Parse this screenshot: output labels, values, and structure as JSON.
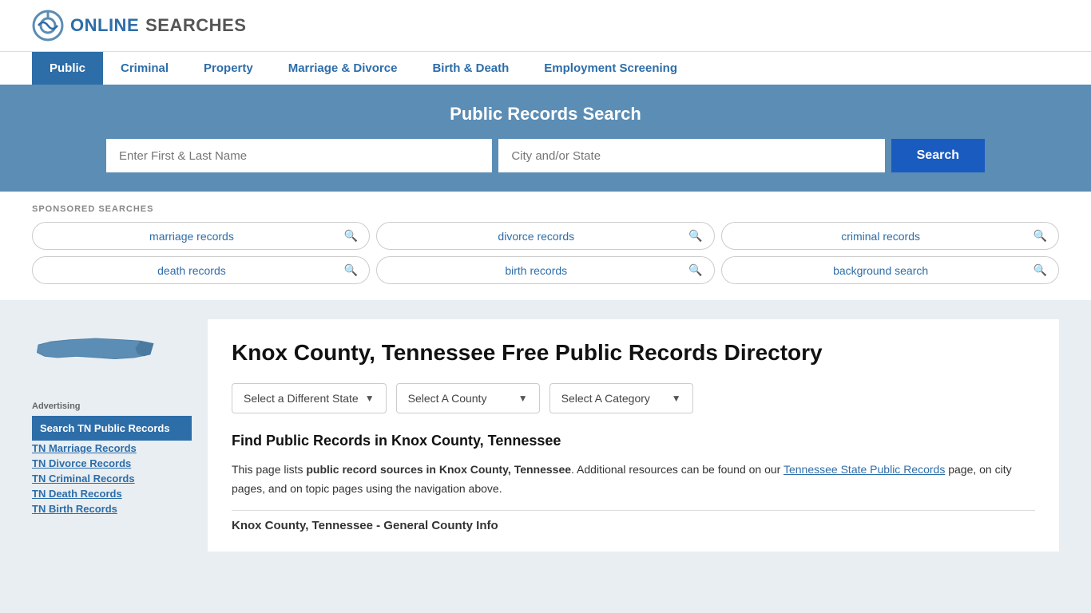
{
  "header": {
    "logo_online": "ONLINE",
    "logo_searches": "SEARCHES"
  },
  "nav": {
    "items": [
      {
        "label": "Public",
        "active": true
      },
      {
        "label": "Criminal",
        "active": false
      },
      {
        "label": "Property",
        "active": false
      },
      {
        "label": "Marriage & Divorce",
        "active": false
      },
      {
        "label": "Birth & Death",
        "active": false
      },
      {
        "label": "Employment Screening",
        "active": false
      }
    ]
  },
  "search_banner": {
    "title": "Public Records Search",
    "name_placeholder": "Enter First & Last Name",
    "location_placeholder": "City and/or State",
    "button_label": "Search"
  },
  "sponsored": {
    "label": "SPONSORED SEARCHES",
    "tags": [
      "marriage records",
      "divorce records",
      "criminal records",
      "death records",
      "birth records",
      "background search"
    ]
  },
  "page": {
    "title": "Knox County, Tennessee Free Public Records Directory",
    "dropdown_state": "Select a Different State",
    "dropdown_county": "Select A County",
    "dropdown_category": "Select A Category",
    "section_heading": "Find Public Records in Knox County, Tennessee",
    "description": "This page lists ",
    "description_bold": "public record sources in Knox County, Tennessee",
    "description_end": ". Additional resources can be found on our ",
    "link_text": "Tennessee State Public Records",
    "description_rest": " page, on city pages, and on topic pages using the navigation above.",
    "county_general_heading": "Knox County, Tennessee - General County Info"
  },
  "sidebar": {
    "advertising_label": "Advertising",
    "ad_highlight": "Search TN Public Records",
    "links": [
      "TN Marriage Records",
      "TN Divorce Records",
      "TN Criminal Records",
      "TN Death Records",
      "TN Birth Records"
    ]
  }
}
